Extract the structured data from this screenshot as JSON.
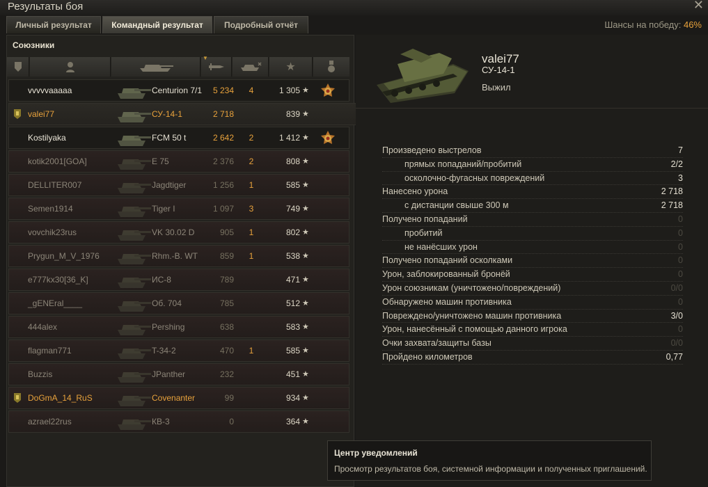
{
  "window": {
    "title": "Результаты боя"
  },
  "tabs": [
    {
      "label": "Личный результат",
      "active": false
    },
    {
      "label": "Командный результат",
      "active": true
    },
    {
      "label": "Подробный отчёт",
      "active": false
    }
  ],
  "win_chance": {
    "label": "Шансы на победу:",
    "value": "46%"
  },
  "allies_label": "Союзники",
  "players": [
    {
      "name": "vvvvvaaaaa",
      "vehicle": "Centurion 7/1",
      "damage": "5 234",
      "frags": "4",
      "xp": "1 305",
      "alive": true,
      "medal": true
    },
    {
      "name": "valei77",
      "vehicle": "СУ-14-1",
      "damage": "2 718",
      "frags": "",
      "xp": "839",
      "alive": true,
      "self": true,
      "badge": true
    },
    {
      "name": "Kostilyaka",
      "vehicle": "FCM 50 t",
      "damage": "2 642",
      "frags": "2",
      "xp": "1 412",
      "alive": true,
      "medal": true
    },
    {
      "name": "kotik2001[GOA]",
      "vehicle": "E 75",
      "damage": "2 376",
      "frags": "2",
      "xp": "808",
      "alive": false
    },
    {
      "name": "DELLITER007",
      "vehicle": "Jagdtiger",
      "damage": "1 256",
      "frags": "1",
      "xp": "585",
      "alive": false
    },
    {
      "name": "Semen1914",
      "vehicle": "Tiger I",
      "damage": "1 097",
      "frags": "3",
      "xp": "749",
      "alive": false
    },
    {
      "name": "vovchik23rus",
      "vehicle": "VK 30.02 D",
      "damage": "905",
      "frags": "1",
      "xp": "802",
      "alive": false
    },
    {
      "name": "Prygun_M_V_1976",
      "vehicle": "Rhm.-B. WT",
      "damage": "859",
      "frags": "1",
      "xp": "538",
      "alive": false
    },
    {
      "name": "e777kx30[36_K]",
      "vehicle": "ИС-8",
      "damage": "789",
      "frags": "",
      "xp": "471",
      "alive": false
    },
    {
      "name": "_gENEral____",
      "vehicle": "Об. 704",
      "damage": "785",
      "frags": "",
      "xp": "512",
      "alive": false
    },
    {
      "name": "444alex",
      "vehicle": "Pershing",
      "damage": "638",
      "frags": "",
      "xp": "583",
      "alive": false
    },
    {
      "name": "flagman771",
      "vehicle": "T-34-2",
      "damage": "470",
      "frags": "1",
      "xp": "585",
      "alive": false
    },
    {
      "name": "Buzzis",
      "vehicle": "JPanther",
      "damage": "232",
      "frags": "",
      "xp": "451",
      "alive": false
    },
    {
      "name": "DoGmA_14_RuS",
      "vehicle": "Covenanter",
      "damage": "99",
      "frags": "",
      "xp": "934",
      "alive": false,
      "gold": true,
      "badge": true
    },
    {
      "name": "azrael22rus",
      "vehicle": "КВ-3",
      "damage": "0",
      "frags": "",
      "xp": "364",
      "alive": false
    }
  ],
  "details": {
    "player": "valei77",
    "vehicle": "СУ-14-1",
    "status": "Выжил",
    "stats": [
      {
        "label": "Произведено выстрелов",
        "value": "7",
        "sub": false,
        "zero": false
      },
      {
        "label": "прямых попаданий/пробитий",
        "value": "2/2",
        "sub": true,
        "zero": false
      },
      {
        "label": "осколочно-фугасных повреждений",
        "value": "3",
        "sub": true,
        "zero": false
      },
      {
        "label": "Нанесено урона",
        "value": "2 718",
        "sub": false,
        "zero": false
      },
      {
        "label": "с дистанции свыше 300 м",
        "value": "2 718",
        "sub": true,
        "zero": false
      },
      {
        "label": "Получено попаданий",
        "value": "0",
        "sub": false,
        "zero": true
      },
      {
        "label": "пробитий",
        "value": "0",
        "sub": true,
        "zero": true
      },
      {
        "label": "не нанёсших урон",
        "value": "0",
        "sub": true,
        "zero": true
      },
      {
        "label": "Получено попаданий осколками",
        "value": "0",
        "sub": false,
        "zero": true
      },
      {
        "label": "Урон, заблокированный бронёй",
        "value": "0",
        "sub": false,
        "zero": true
      },
      {
        "label": "Урон союзникам (уничтожено/повреждений)",
        "value": "0/0",
        "sub": false,
        "zero": true
      },
      {
        "label": "Обнаружено машин противника",
        "value": "0",
        "sub": false,
        "zero": true
      },
      {
        "label": "Повреждено/уничтожено машин противника",
        "value": "3/0",
        "sub": false,
        "zero": false
      },
      {
        "label": "Урон, нанесённый с помощью данного игрока",
        "value": "0",
        "sub": false,
        "zero": true
      },
      {
        "label": "Очки захвата/защиты базы",
        "value": "0/0",
        "sub": false,
        "zero": true
      },
      {
        "label": "Пройдено километров",
        "value": "0,77",
        "sub": false,
        "zero": false
      }
    ]
  },
  "notification": {
    "title": "Центр уведомлений",
    "text": "Просмотр результатов боя, системной информации и полученных приглашений."
  },
  "colors": {
    "accent": "#e8a23c",
    "background": "#1b1a18"
  }
}
